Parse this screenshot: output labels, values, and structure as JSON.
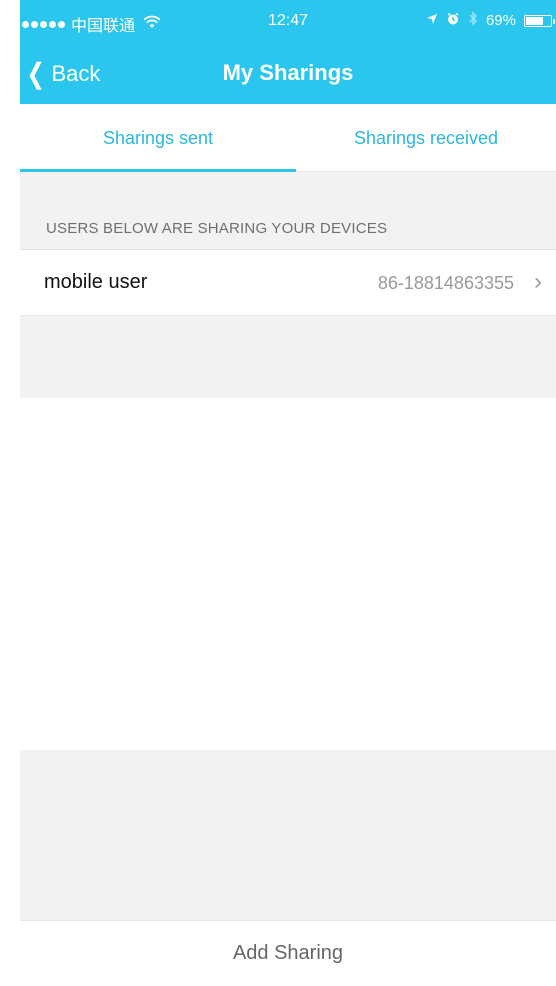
{
  "status_bar": {
    "carrier": "中国联通",
    "time": "12:47",
    "battery_percent": "69%",
    "battery_level": 0.69,
    "icons": [
      "signal-dots-icon",
      "wifi-icon",
      "location-arrow-icon",
      "alarm-icon",
      "bluetooth-icon",
      "battery-icon"
    ]
  },
  "nav": {
    "back_label": "Back",
    "title": "My Sharings"
  },
  "tabs": [
    {
      "label": "Sharings sent",
      "selected": true
    },
    {
      "label": "Sharings received",
      "selected": false
    }
  ],
  "section": {
    "header": "USERS BELOW ARE SHARING YOUR DEVICES"
  },
  "rows": [
    {
      "name": "mobile user",
      "phone": "86-18814863355"
    }
  ],
  "actions": {
    "add_sharing": "Add Sharing"
  },
  "colors": {
    "accent": "#2bc6ee",
    "tab_text": "#2bb7de",
    "background": "#f2f2f2"
  }
}
